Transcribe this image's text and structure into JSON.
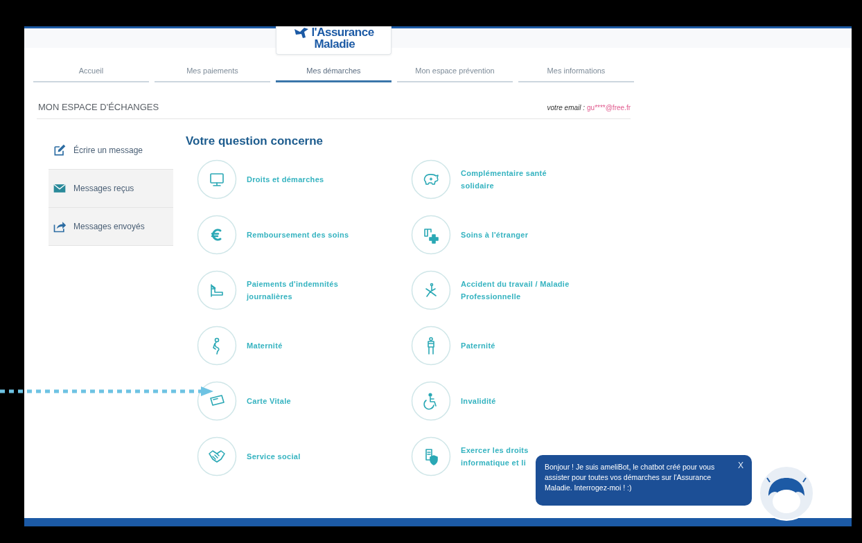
{
  "logo": {
    "line1": "l'Assurance",
    "line2": "Maladie"
  },
  "nav": [
    {
      "label": "Accueil",
      "selected": false
    },
    {
      "label": "Mes paiements",
      "selected": false
    },
    {
      "label": "Mes démarches",
      "selected": true
    },
    {
      "label": "Mon espace prévention",
      "selected": false
    },
    {
      "label": "Mes informations",
      "selected": false
    }
  ],
  "header": {
    "title": "MON ESPACE D'ÉCHANGES",
    "email_label": "votre email :",
    "email": "gu****@free.fr"
  },
  "sidebar": [
    {
      "label": "Écrire un message",
      "shaded": false
    },
    {
      "label": "Messages reçus",
      "shaded": true
    },
    {
      "label": "Messages envoyés",
      "shaded": true
    }
  ],
  "heading": "Votre question concerne",
  "topics": [
    {
      "lines": [
        "Droits et démarches"
      ]
    },
    {
      "lines": [
        "Remboursement des soins"
      ]
    },
    {
      "lines": [
        "Paiements d'indemnités",
        "journalières"
      ]
    },
    {
      "lines": [
        "Maternité"
      ]
    },
    {
      "lines": [
        "Carte Vitale"
      ]
    },
    {
      "lines": [
        "Service social"
      ]
    },
    {
      "lines": [
        "Complémentaire santé",
        "solidaire"
      ]
    },
    {
      "lines": [
        "Soins à l'étranger"
      ]
    },
    {
      "lines": [
        "Accident du travail / Maladie",
        "Professionnelle"
      ]
    },
    {
      "lines": [
        "Paternité"
      ]
    },
    {
      "lines": [
        "Invalidité"
      ]
    },
    {
      "lines": [
        "Exercer les droits",
        "informatique et li"
      ]
    }
  ],
  "chatbot": {
    "message": "Bonjour ! Je suis ameliBot, le chatbot créé pour vous assister pour toutes vos démarches sur l'Assurance Maladie. Interrogez-moi ! :)",
    "close": "X"
  }
}
